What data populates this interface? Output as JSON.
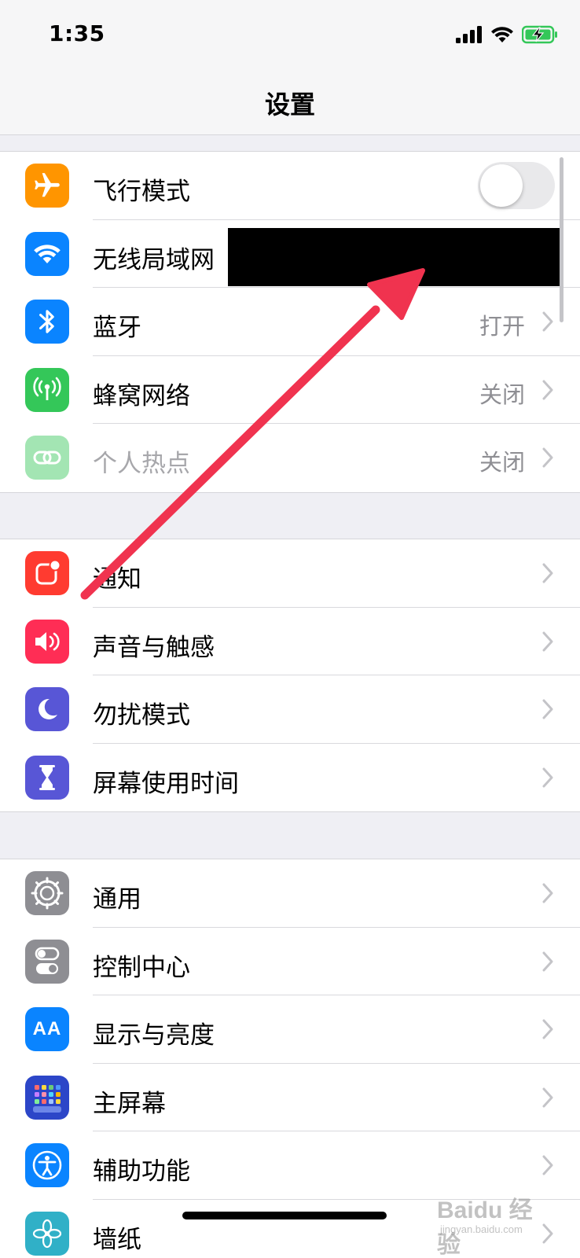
{
  "status_bar": {
    "time": "1:35"
  },
  "nav": {
    "title": "设置"
  },
  "groups": [
    {
      "rows": [
        {
          "label": "飞行模式",
          "value": "",
          "icon": "airplane-icon",
          "color": "#ff9500",
          "control": "toggle",
          "toggle_on": false
        },
        {
          "label": "无线局域网",
          "value": "",
          "icon": "wifi-icon",
          "color": "#0a84ff",
          "control": "redacted"
        },
        {
          "label": "蓝牙",
          "value": "打开",
          "icon": "bluetooth-icon",
          "color": "#0a84ff",
          "control": "chevron"
        },
        {
          "label": "蜂窝网络",
          "value": "关闭",
          "icon": "cellular-icon",
          "color": "#34c759",
          "control": "chevron"
        },
        {
          "label": "个人热点",
          "value": "关闭",
          "icon": "hotspot-icon",
          "color": "#34c759",
          "control": "chevron",
          "disabled": true
        }
      ]
    },
    {
      "rows": [
        {
          "label": "通知",
          "value": "",
          "icon": "notifications-icon",
          "color": "#ff3b30",
          "control": "chevron"
        },
        {
          "label": "声音与触感",
          "value": "",
          "icon": "sound-icon",
          "color": "#ff2d55",
          "control": "chevron"
        },
        {
          "label": "勿扰模式",
          "value": "",
          "icon": "moon-icon",
          "color": "#5856d6",
          "control": "chevron"
        },
        {
          "label": "屏幕使用时间",
          "value": "",
          "icon": "hourglass-icon",
          "color": "#5856d6",
          "control": "chevron"
        }
      ]
    },
    {
      "rows": [
        {
          "label": "通用",
          "value": "",
          "icon": "gear-icon",
          "color": "#8e8e93",
          "control": "chevron"
        },
        {
          "label": "控制中心",
          "value": "",
          "icon": "toggles-icon",
          "color": "#8e8e93",
          "control": "chevron"
        },
        {
          "label": "显示与亮度",
          "value": "",
          "icon": "text-size-icon",
          "color": "#0a84ff",
          "control": "chevron"
        },
        {
          "label": "主屏幕",
          "value": "",
          "icon": "home-screen-icon",
          "color": "#2c46c8",
          "control": "chevron"
        },
        {
          "label": "辅助功能",
          "value": "",
          "icon": "accessibility-icon",
          "color": "#0a84ff",
          "control": "chevron"
        },
        {
          "label": "墙纸",
          "value": "",
          "icon": "wallpaper-icon",
          "color": "#30b0c7",
          "control": "chevron"
        }
      ]
    }
  ],
  "display_text": {
    "wallpaper_icon_glyph": "AA"
  },
  "annotation": {
    "color": "#f0334f"
  },
  "watermark": {
    "text": "Baidu 经验",
    "sub": "jingyan.baidu.com"
  }
}
